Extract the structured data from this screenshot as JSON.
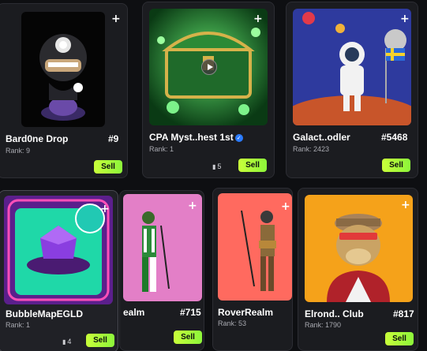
{
  "cards": [
    {
      "name": "Bard0ne Drop",
      "number": "#9",
      "rank": "Rank: 9",
      "sell": "Sell",
      "plus": "+"
    },
    {
      "name": "CPA Myst..hest 1st",
      "number": "",
      "rank": "Rank: 1",
      "sell": "Sell",
      "plus": "+",
      "count": "5",
      "verified_icon": "verified-badge-icon"
    },
    {
      "name": "Galact..odler",
      "number": "#5468",
      "rank": "Rank: 2423",
      "sell": "Sell",
      "plus": "+"
    },
    {
      "name": "BubbleMapEGLD",
      "number": "",
      "rank": "Rank: 1",
      "sell": "Sell",
      "plus": "+",
      "count": "4"
    },
    {
      "name": "ealm",
      "number": "#715",
      "rank": "",
      "sell": "Sell",
      "plus": "+"
    },
    {
      "name": "RoverRealm",
      "number": "",
      "rank": "Rank: 53",
      "sell": "Sell",
      "plus": "+"
    },
    {
      "name": "Elrond.. Club",
      "number": "#817",
      "rank": "Rank: 1790",
      "sell": "Sell",
      "plus": "+"
    }
  ],
  "icons": {
    "add": "plus-icon",
    "stack": "stack-icon",
    "play": "play-icon",
    "shield": "shield-icon"
  },
  "colors": {
    "sell_button": "#a8f53a",
    "verified": "#2a7bff",
    "background": "#0e0f12",
    "card": "#1b1c20"
  }
}
